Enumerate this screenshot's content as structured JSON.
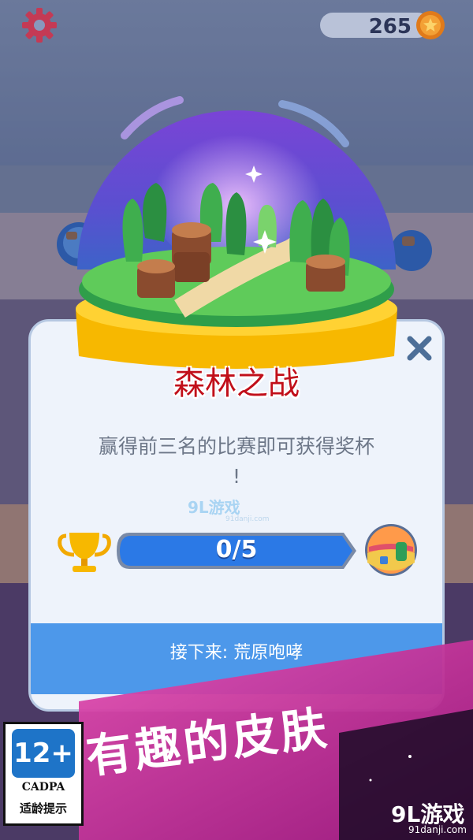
{
  "hud": {
    "coins": "265",
    "settings_icon": "gear-icon",
    "coin_icon": "coin-icon"
  },
  "arena": {
    "name": "森林之战",
    "description_line1": "赢得前三名的比赛即可获得奖杯",
    "description_line2": "!",
    "progress_text": "0/5",
    "progress_current": 0,
    "progress_total": 5,
    "next_arena_label": "接下来: 荒原咆哮"
  },
  "watermark": {
    "main": "9L游戏",
    "sub": "91danji.com"
  },
  "promo": {
    "banner_text": "有趣的皮肤"
  },
  "age_rating": {
    "age": "12+",
    "org": "CADPA",
    "tip": "适龄提示"
  },
  "corner_logo": {
    "main": "9L游戏",
    "sub": "91danji.com"
  },
  "colors": {
    "title_red": "#c10f1a",
    "progress_blue": "#2b79e6",
    "footer_blue": "#4d98ea",
    "dome_purple": "#6a3fd0",
    "gold": "#f7b800"
  }
}
